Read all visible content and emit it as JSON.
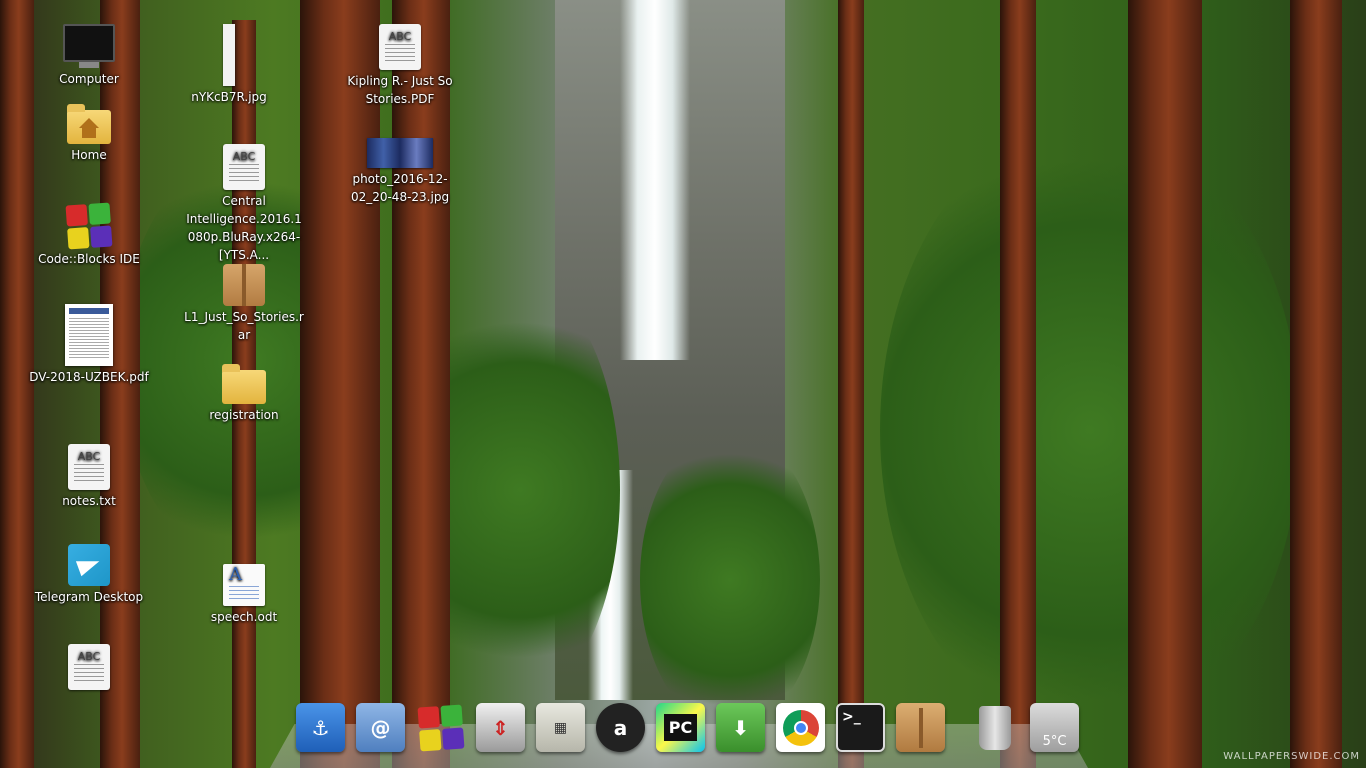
{
  "desktop": {
    "icons": [
      {
        "label": "Computer",
        "icon": "computer-icon"
      },
      {
        "label": "Home",
        "icon": "home-folder-icon"
      },
      {
        "label": "Code::Blocks IDE",
        "icon": "codeblocks-icon"
      },
      {
        "label": "DV-2018-UZBEK.pdf",
        "icon": "pdf-document-icon"
      },
      {
        "label": "notes.txt",
        "icon": "text-file-icon"
      },
      {
        "label": "Telegram Desktop",
        "icon": "telegram-icon"
      },
      {
        "label": "",
        "icon": "text-file-icon"
      },
      {
        "label": "nYKcB7R.jpg",
        "icon": "image-file-icon"
      },
      {
        "label": "Central Intelligence.2016.1080p.BluRay.x264-[YTS.A...",
        "icon": "text-file-icon"
      },
      {
        "label": "L1_Just_So_Stories.rar",
        "icon": "archive-icon"
      },
      {
        "label": "registration",
        "icon": "folder-icon"
      },
      {
        "label": "speech.odt",
        "icon": "odt-document-icon"
      },
      {
        "label": "Kipling R.- Just So Stories.PDF",
        "icon": "text-file-icon"
      },
      {
        "label": "photo_2016-12-02_20-48-23.jpg",
        "icon": "photo-thumbnail-icon"
      }
    ],
    "doc_badge": "ABC"
  },
  "dock": {
    "items": [
      {
        "name": "docky-anchor",
        "icon": "anchor-icon",
        "color": "#2f78d0"
      },
      {
        "name": "app-swirl",
        "icon": "swirl-icon",
        "color": "#5f8fc8"
      },
      {
        "name": "codeblocks",
        "icon": "codeblocks-icon",
        "color": "#cc3333"
      },
      {
        "name": "window-resizer",
        "icon": "resize-icon",
        "color": "#9a9a9a"
      },
      {
        "name": "calculator",
        "icon": "calculator-icon",
        "color": "#cfcfc4"
      },
      {
        "name": "amazon",
        "icon": "amazon-icon",
        "color": "#222222",
        "glyph": "a"
      },
      {
        "name": "pycharm",
        "icon": "pycharm-icon",
        "color": "#111111",
        "glyph": "PC"
      },
      {
        "name": "update-manager",
        "icon": "download-icon",
        "color": "#4aa53a"
      },
      {
        "name": "chrome",
        "icon": "chrome-icon",
        "color": "#ffffff"
      },
      {
        "name": "terminal",
        "icon": "terminal-icon",
        "color": "#1a1a1a",
        "glyph": ">_"
      },
      {
        "name": "archive-manager",
        "icon": "archive-icon",
        "color": "#c8995e"
      },
      {
        "name": "trash",
        "icon": "trash-icon",
        "color": "#b8b8b8"
      },
      {
        "name": "weather",
        "icon": "weather-icon",
        "color": "#bdbdbd"
      }
    ],
    "weather_temp": "5°C"
  },
  "watermark": "WALLPAPERSWIDE.COM"
}
